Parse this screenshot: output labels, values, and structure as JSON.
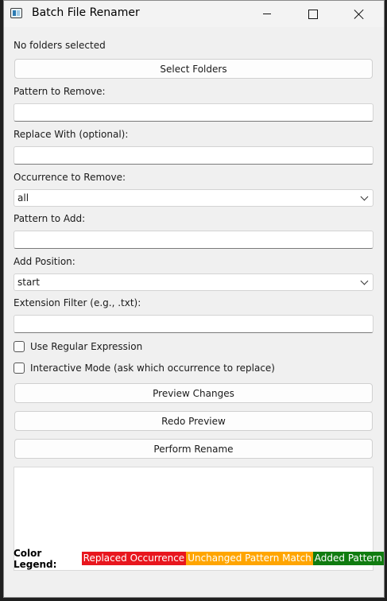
{
  "window": {
    "title": "Batch File Renamer"
  },
  "folder_status": "No folders selected",
  "buttons": {
    "select_folders": "Select Folders",
    "preview": "Preview Changes",
    "redo": "Redo Preview",
    "perform": "Perform Rename"
  },
  "fields": {
    "pattern_remove": {
      "label": "Pattern to Remove:",
      "value": ""
    },
    "replace_with": {
      "label": "Replace With (optional):",
      "value": ""
    },
    "occurrence": {
      "label": "Occurrence to Remove:",
      "value": "all"
    },
    "pattern_add": {
      "label": "Pattern to Add:",
      "value": ""
    },
    "add_position": {
      "label": "Add Position:",
      "value": "start"
    },
    "extension_filter": {
      "label": "Extension Filter (e.g., .txt):",
      "value": ""
    }
  },
  "checkboxes": {
    "regex": {
      "label": "Use Regular Expression",
      "checked": false
    },
    "interactive": {
      "label": "Interactive Mode (ask which occurrence to replace)",
      "checked": false
    }
  },
  "legend": {
    "title": "Color Legend:",
    "items": [
      {
        "label": "Replaced Occurrence",
        "color": "#e8161e"
      },
      {
        "label": "Unchanged Pattern Match",
        "color": "#ffa500"
      },
      {
        "label": "Added Pattern",
        "color": "#107c10"
      }
    ]
  }
}
